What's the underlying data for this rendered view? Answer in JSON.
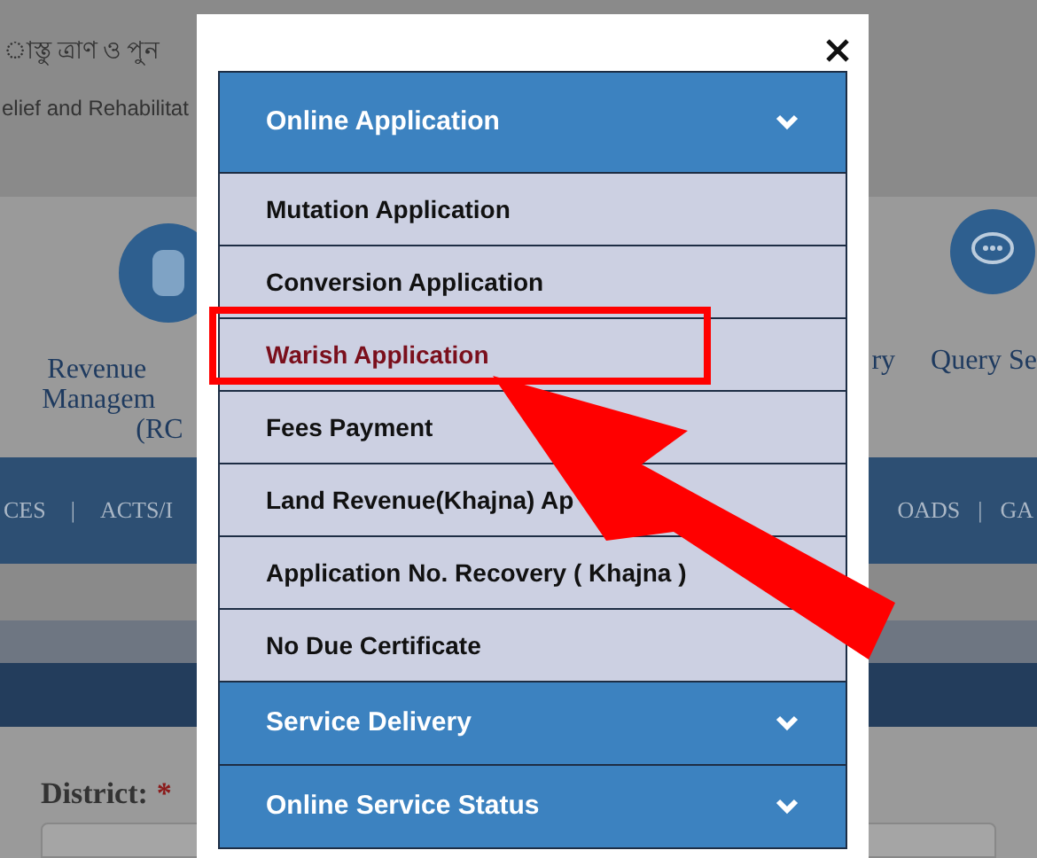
{
  "header": {
    "title_bn": "াস্তু ত্রাণ ও পুন",
    "subtitle": "elief and Rehabilitat"
  },
  "services": {
    "left_label": [
      "Revenue",
      "Managem",
      "(RC"
    ],
    "right_partial": "ry",
    "right_label": "Query Se"
  },
  "nav": [
    "CES",
    "|",
    "ACTS/I",
    "OADS",
    "|",
    "GA"
  ],
  "form": {
    "label": "District:",
    "required": "*"
  },
  "modal": {
    "sections": [
      {
        "title": "Online Application",
        "items": [
          {
            "label": "Mutation Application",
            "selected": false
          },
          {
            "label": "Conversion Application",
            "selected": false
          },
          {
            "label": "Warish Application",
            "selected": true
          },
          {
            "label": "Fees Payment",
            "selected": false
          },
          {
            "label": "Land Revenue(Khajna) Ap",
            "selected": false
          },
          {
            "label": "Application No. Recovery ( Khajna )",
            "selected": false
          },
          {
            "label": "No Due Certificate",
            "selected": false
          }
        ]
      },
      {
        "title": "Service Delivery"
      },
      {
        "title": "Online Service Status"
      }
    ]
  }
}
